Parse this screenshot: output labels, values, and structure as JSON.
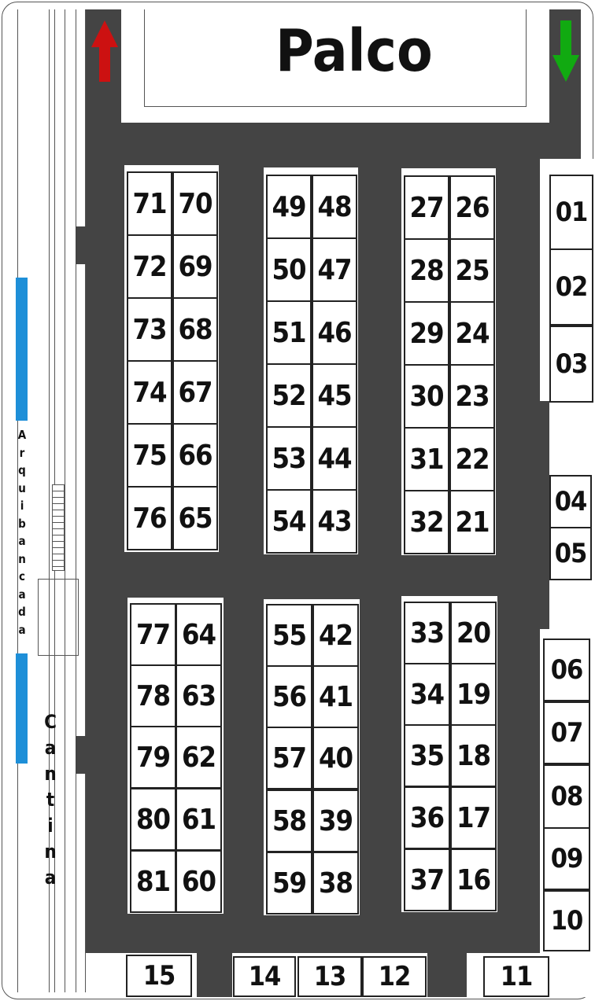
{
  "stage": {
    "label": "Palco"
  },
  "arrows": {
    "left": {
      "icon": "arrow-up-icon",
      "color": "#cc1111"
    },
    "right": {
      "icon": "arrow-down-icon",
      "color": "#11aa11"
    }
  },
  "colors": {
    "floor": "#444444",
    "bleacher_bar": "#1e8fd8"
  },
  "arquibancada": "Arquibancada",
  "cantina": "Cantina",
  "blocks": {
    "a": {
      "rows": [
        [
          "71",
          "70"
        ],
        [
          "72",
          "69"
        ],
        [
          "73",
          "68"
        ],
        [
          "74",
          "67"
        ],
        [
          "75",
          "66"
        ],
        [
          "76",
          "65"
        ]
      ]
    },
    "b": {
      "rows": [
        [
          "49",
          "48"
        ],
        [
          "50",
          "47"
        ],
        [
          "51",
          "46"
        ],
        [
          "52",
          "45"
        ],
        [
          "53",
          "44"
        ],
        [
          "54",
          "43"
        ]
      ]
    },
    "c": {
      "rows": [
        [
          "27",
          "26"
        ],
        [
          "28",
          "25"
        ],
        [
          "29",
          "24"
        ],
        [
          "30",
          "23"
        ],
        [
          "31",
          "22"
        ],
        [
          "32",
          "21"
        ]
      ]
    },
    "d": {
      "rows": [
        [
          "77",
          "64"
        ],
        [
          "78",
          "63"
        ],
        [
          "79",
          "62"
        ],
        [
          "80",
          "61"
        ],
        [
          "81",
          "60"
        ]
      ]
    },
    "e": {
      "rows": [
        [
          "55",
          "42"
        ],
        [
          "56",
          "41"
        ],
        [
          "57",
          "40"
        ],
        [
          "58",
          "39"
        ],
        [
          "59",
          "38"
        ]
      ]
    },
    "f": {
      "rows": [
        [
          "33",
          "20"
        ],
        [
          "34",
          "19"
        ],
        [
          "35",
          "18"
        ],
        [
          "36",
          "17"
        ],
        [
          "37",
          "16"
        ]
      ]
    }
  },
  "right_stalls": [
    "01",
    "02",
    "03",
    "04",
    "05",
    "06",
    "07",
    "08",
    "09",
    "10"
  ],
  "bottom_stalls": [
    "15",
    "14",
    "13",
    "12",
    "11"
  ]
}
